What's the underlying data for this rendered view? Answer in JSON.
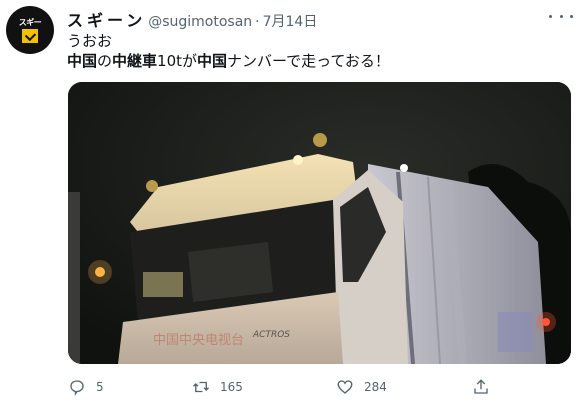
{
  "tweet": {
    "avatar_text": "スギー",
    "display_name": "スギーン",
    "handle": "@sugimotosan",
    "separator": "·",
    "date": "7月14日",
    "text_line1": "うおお",
    "text_line2_parts": [
      {
        "text": "中国",
        "bold": true
      },
      {
        "text": "の",
        "bold": false
      },
      {
        "text": "中継車",
        "bold": true
      },
      {
        "text": "10tが",
        "bold": false
      },
      {
        "text": "中国",
        "bold": true
      },
      {
        "text": "ナンバーで走っておる！",
        "bold": false
      }
    ],
    "media_text": {
      "truck_side_text": "中国中央电视台",
      "truck_model": "ACTROS"
    },
    "actions": {
      "reply_count": "5",
      "retweet_count": "165",
      "like_count": "284"
    }
  },
  "icons": [
    "more-icon",
    "reply-icon",
    "retweet-icon",
    "like-icon",
    "share-icon"
  ],
  "colors": {
    "secondary_text": "#536471",
    "primary_text": "#0f1419"
  }
}
